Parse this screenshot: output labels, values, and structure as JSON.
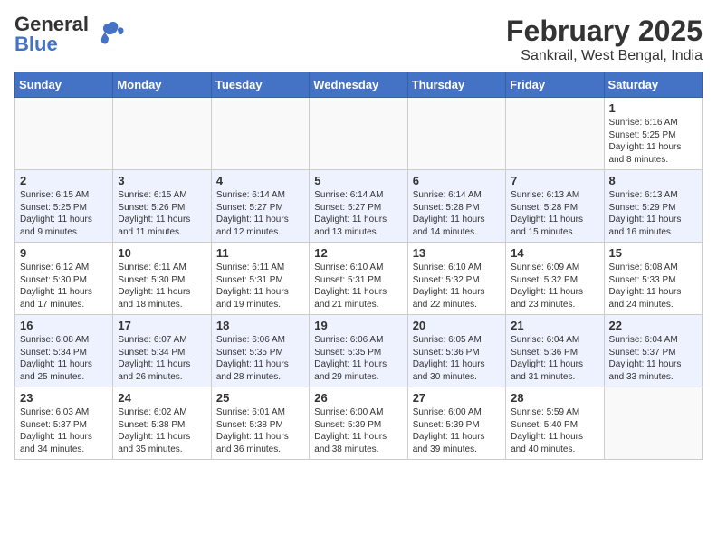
{
  "logo": {
    "line1": "General",
    "line2": "Blue"
  },
  "title": "February 2025",
  "subtitle": "Sankrail, West Bengal, India",
  "days_of_week": [
    "Sunday",
    "Monday",
    "Tuesday",
    "Wednesday",
    "Thursday",
    "Friday",
    "Saturday"
  ],
  "weeks": [
    [
      {
        "day": "",
        "info": ""
      },
      {
        "day": "",
        "info": ""
      },
      {
        "day": "",
        "info": ""
      },
      {
        "day": "",
        "info": ""
      },
      {
        "day": "",
        "info": ""
      },
      {
        "day": "",
        "info": ""
      },
      {
        "day": "1",
        "info": "Sunrise: 6:16 AM\nSunset: 5:25 PM\nDaylight: 11 hours and 8 minutes."
      }
    ],
    [
      {
        "day": "2",
        "info": "Sunrise: 6:15 AM\nSunset: 5:25 PM\nDaylight: 11 hours and 9 minutes."
      },
      {
        "day": "3",
        "info": "Sunrise: 6:15 AM\nSunset: 5:26 PM\nDaylight: 11 hours and 11 minutes."
      },
      {
        "day": "4",
        "info": "Sunrise: 6:14 AM\nSunset: 5:27 PM\nDaylight: 11 hours and 12 minutes."
      },
      {
        "day": "5",
        "info": "Sunrise: 6:14 AM\nSunset: 5:27 PM\nDaylight: 11 hours and 13 minutes."
      },
      {
        "day": "6",
        "info": "Sunrise: 6:14 AM\nSunset: 5:28 PM\nDaylight: 11 hours and 14 minutes."
      },
      {
        "day": "7",
        "info": "Sunrise: 6:13 AM\nSunset: 5:28 PM\nDaylight: 11 hours and 15 minutes."
      },
      {
        "day": "8",
        "info": "Sunrise: 6:13 AM\nSunset: 5:29 PM\nDaylight: 11 hours and 16 minutes."
      }
    ],
    [
      {
        "day": "9",
        "info": "Sunrise: 6:12 AM\nSunset: 5:30 PM\nDaylight: 11 hours and 17 minutes."
      },
      {
        "day": "10",
        "info": "Sunrise: 6:11 AM\nSunset: 5:30 PM\nDaylight: 11 hours and 18 minutes."
      },
      {
        "day": "11",
        "info": "Sunrise: 6:11 AM\nSunset: 5:31 PM\nDaylight: 11 hours and 19 minutes."
      },
      {
        "day": "12",
        "info": "Sunrise: 6:10 AM\nSunset: 5:31 PM\nDaylight: 11 hours and 21 minutes."
      },
      {
        "day": "13",
        "info": "Sunrise: 6:10 AM\nSunset: 5:32 PM\nDaylight: 11 hours and 22 minutes."
      },
      {
        "day": "14",
        "info": "Sunrise: 6:09 AM\nSunset: 5:32 PM\nDaylight: 11 hours and 23 minutes."
      },
      {
        "day": "15",
        "info": "Sunrise: 6:08 AM\nSunset: 5:33 PM\nDaylight: 11 hours and 24 minutes."
      }
    ],
    [
      {
        "day": "16",
        "info": "Sunrise: 6:08 AM\nSunset: 5:34 PM\nDaylight: 11 hours and 25 minutes."
      },
      {
        "day": "17",
        "info": "Sunrise: 6:07 AM\nSunset: 5:34 PM\nDaylight: 11 hours and 26 minutes."
      },
      {
        "day": "18",
        "info": "Sunrise: 6:06 AM\nSunset: 5:35 PM\nDaylight: 11 hours and 28 minutes."
      },
      {
        "day": "19",
        "info": "Sunrise: 6:06 AM\nSunset: 5:35 PM\nDaylight: 11 hours and 29 minutes."
      },
      {
        "day": "20",
        "info": "Sunrise: 6:05 AM\nSunset: 5:36 PM\nDaylight: 11 hours and 30 minutes."
      },
      {
        "day": "21",
        "info": "Sunrise: 6:04 AM\nSunset: 5:36 PM\nDaylight: 11 hours and 31 minutes."
      },
      {
        "day": "22",
        "info": "Sunrise: 6:04 AM\nSunset: 5:37 PM\nDaylight: 11 hours and 33 minutes."
      }
    ],
    [
      {
        "day": "23",
        "info": "Sunrise: 6:03 AM\nSunset: 5:37 PM\nDaylight: 11 hours and 34 minutes."
      },
      {
        "day": "24",
        "info": "Sunrise: 6:02 AM\nSunset: 5:38 PM\nDaylight: 11 hours and 35 minutes."
      },
      {
        "day": "25",
        "info": "Sunrise: 6:01 AM\nSunset: 5:38 PM\nDaylight: 11 hours and 36 minutes."
      },
      {
        "day": "26",
        "info": "Sunrise: 6:00 AM\nSunset: 5:39 PM\nDaylight: 11 hours and 38 minutes."
      },
      {
        "day": "27",
        "info": "Sunrise: 6:00 AM\nSunset: 5:39 PM\nDaylight: 11 hours and 39 minutes."
      },
      {
        "day": "28",
        "info": "Sunrise: 5:59 AM\nSunset: 5:40 PM\nDaylight: 11 hours and 40 minutes."
      },
      {
        "day": "",
        "info": ""
      }
    ]
  ]
}
